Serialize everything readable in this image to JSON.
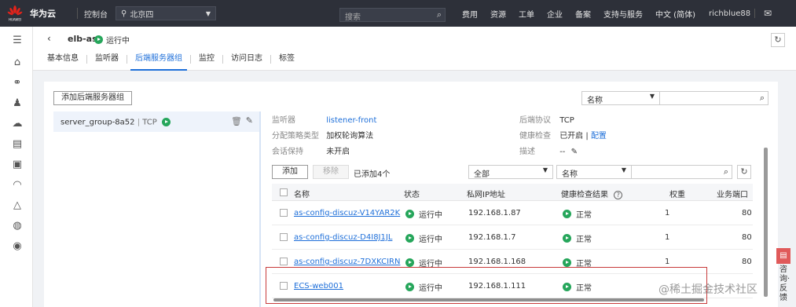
{
  "topbar": {
    "brand_logo_text": "HUAWEI",
    "brand": "华为云",
    "console": "控制台",
    "region": "北京四",
    "search_placeholder": "搜索",
    "links": [
      "费用",
      "资源",
      "工单",
      "企业",
      "备案",
      "支持与服务",
      "中文 (简体)"
    ],
    "user": "richblue88"
  },
  "header": {
    "name": "elb-as",
    "status": "运行中",
    "tabs": [
      "基本信息",
      "监听器",
      "后端服务器组",
      "监控",
      "访问日志",
      "标签"
    ],
    "active_tab": "后端服务器组"
  },
  "panel": {
    "add_group_label": "添加后端服务器组",
    "filter_select": "名称",
    "group": {
      "name": "server_group-8a52",
      "protocol": "TCP"
    },
    "info": {
      "listener_k": "监听器",
      "listener_v": "listener-front",
      "algo_k": "分配策略类型",
      "algo_v": "加权轮询算法",
      "session_k": "会话保持",
      "session_v": "未开启",
      "proto_k": "后端协议",
      "proto_v": "TCP",
      "health_k": "健康检查",
      "health_v": "已开启",
      "health_sep": "|",
      "health_link": "配置",
      "desc_k": "描述",
      "desc_v": "--"
    },
    "toolbar": {
      "add": "添加",
      "remove": "移除",
      "added": "已添加4个",
      "all": "全部",
      "name": "名称"
    },
    "table": {
      "headers": [
        "名称",
        "状态",
        "私网IP地址",
        "健康检查结果",
        "权重",
        "业务端口"
      ],
      "rows": [
        {
          "name": "as-config-discuz-V14YAR2K",
          "status": "运行中",
          "ip": "192.168.1.87",
          "health": "正常",
          "weight": "1",
          "port": "80"
        },
        {
          "name": "as-config-discuz-D4I8J1JL",
          "status": "运行中",
          "ip": "192.168.1.7",
          "health": "正常",
          "weight": "1",
          "port": "80"
        },
        {
          "name": "as-config-discuz-7DXKCIRN",
          "status": "运行中",
          "ip": "192.168.1.168",
          "health": "正常",
          "weight": "1",
          "port": "80"
        },
        {
          "name": "ECS-web001",
          "status": "运行中",
          "ip": "192.168.1.111",
          "health": "正常",
          "weight": "",
          "port": ""
        }
      ]
    }
  },
  "float": {
    "text": "咨询·反馈"
  },
  "watermark": "@稀土掘金技术社区",
  "colors": {
    "topbar": "#2d3039",
    "accent": "#1e6fd9",
    "ok_green": "#26a65b",
    "highlight_red": "#c83a3a"
  }
}
